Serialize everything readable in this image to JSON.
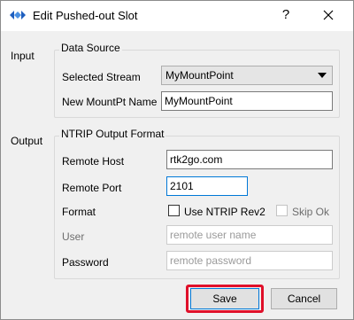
{
  "window": {
    "title": "Edit Pushed-out Slot",
    "help_glyph": "?",
    "app_icon": "diamond-arrows-icon",
    "close_icon": "close-icon"
  },
  "input_section": {
    "side_label": "Input",
    "group_title": "Data Source",
    "selected_stream_label": "Selected Stream",
    "selected_stream_value": "MyMountPoint",
    "new_mountpt_label": "New MountPt Name",
    "new_mountpt_value": "MyMountPoint"
  },
  "output_section": {
    "side_label": "Output",
    "group_title": "NTRIP Output Format",
    "remote_host_label": "Remote Host",
    "remote_host_value": "rtk2go.com",
    "remote_port_label": "Remote Port",
    "remote_port_value": "2101",
    "format_label": "Format",
    "use_ntrip_rev2_label": "Use NTRIP Rev2",
    "skip_ok_label": "Skip Ok",
    "user_label": "User",
    "user_placeholder": "remote user name",
    "password_label": "Password",
    "password_placeholder": "remote password"
  },
  "buttons": {
    "save_label": "Save",
    "cancel_label": "Cancel"
  },
  "colors": {
    "highlight": "#e0102a",
    "focus_border": "#0078d7"
  }
}
